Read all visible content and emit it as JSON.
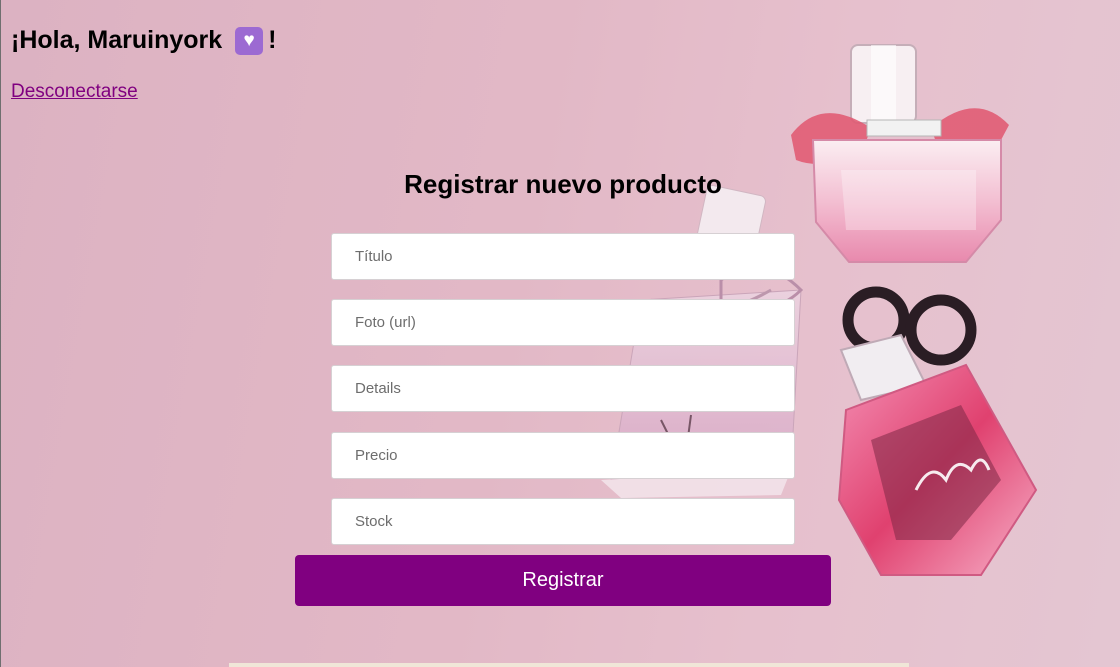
{
  "header": {
    "greeting": "¡Hola, Maruinyork",
    "greeting_end": "!",
    "heart_icon": "purple-heart-emoji",
    "logout_label": "Desconectarse"
  },
  "form": {
    "title": "Registrar nuevo producto",
    "fields": [
      {
        "placeholder": "Título",
        "value": ""
      },
      {
        "placeholder": "Foto (url)",
        "value": ""
      },
      {
        "placeholder": "Details",
        "value": ""
      },
      {
        "placeholder": "Precio",
        "value": ""
      },
      {
        "placeholder": "Stock",
        "value": ""
      }
    ],
    "submit_label": "Registrar"
  },
  "colors": {
    "background": "#e0b6c5",
    "accent": "#800080",
    "link": "#800080",
    "heart_badge": "#9c6ad2"
  }
}
